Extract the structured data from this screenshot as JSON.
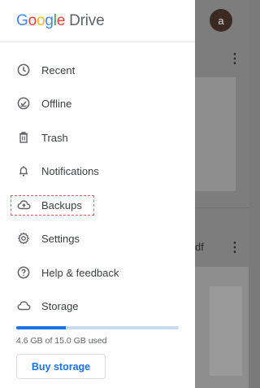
{
  "app": {
    "logo_google": "Google",
    "logo_product": "Drive"
  },
  "background": {
    "avatar_letter": "a",
    "file_name_fragment": "df"
  },
  "menu": {
    "items": [
      {
        "label": "Recent",
        "icon": "clock-icon"
      },
      {
        "label": "Offline",
        "icon": "offline-check-icon"
      },
      {
        "label": "Trash",
        "icon": "trash-icon"
      },
      {
        "label": "Notifications",
        "icon": "bell-icon"
      },
      {
        "label": "Backups",
        "icon": "cloud-upload-icon"
      },
      {
        "label": "Settings",
        "icon": "gear-icon"
      },
      {
        "label": "Help & feedback",
        "icon": "help-icon"
      },
      {
        "label": "Storage",
        "icon": "cloud-icon"
      }
    ]
  },
  "storage": {
    "used_text": "4.6 GB of 15.0 GB used",
    "used_fraction": 0.3067,
    "buy_label": "Buy storage"
  },
  "colors": {
    "accent": "#1a73e8",
    "highlight_box": "#e25b5b"
  }
}
